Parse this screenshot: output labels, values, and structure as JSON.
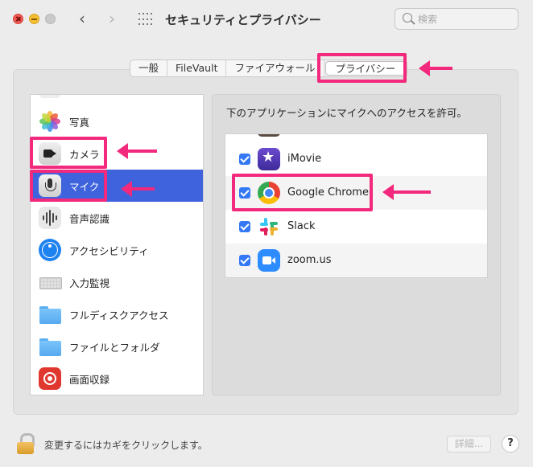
{
  "window": {
    "title": "セキュリティとプライバシー",
    "search_placeholder": "検索"
  },
  "tabs": [
    {
      "label": "一般",
      "active": false
    },
    {
      "label": "FileVault",
      "active": false
    },
    {
      "label": "ファイアウォール",
      "active": false
    },
    {
      "label": "プライバシー",
      "active": true
    }
  ],
  "sidebar": {
    "items": [
      {
        "label": "写真",
        "icon": "photos-icon",
        "selected": false
      },
      {
        "label": "カメラ",
        "icon": "camera-icon",
        "selected": false
      },
      {
        "label": "マイク",
        "icon": "microphone-icon",
        "selected": true
      },
      {
        "label": "音声認識",
        "icon": "speech-recognition-icon",
        "selected": false
      },
      {
        "label": "アクセシビリティ",
        "icon": "accessibility-icon",
        "selected": false
      },
      {
        "label": "入力監視",
        "icon": "keyboard-icon",
        "selected": false
      },
      {
        "label": "フルディスクアクセス",
        "icon": "folder-icon",
        "selected": false
      },
      {
        "label": "ファイルとフォルダ",
        "icon": "folder-icon",
        "selected": false
      },
      {
        "label": "画面収録",
        "icon": "screen-recording-icon",
        "selected": false
      }
    ]
  },
  "detail": {
    "heading": "下のアプリケーションにマイクへのアクセスを許可。",
    "apps": [
      {
        "name": "iMovie",
        "checked": true,
        "icon": "imovie-icon"
      },
      {
        "name": "Google Chrome",
        "checked": true,
        "icon": "chrome-icon"
      },
      {
        "name": "Slack",
        "checked": true,
        "icon": "slack-icon"
      },
      {
        "name": "zoom.us",
        "checked": true,
        "icon": "zoom-icon"
      }
    ]
  },
  "footer": {
    "lock_text": "変更するにはカギをクリックします。",
    "details_label": "詳細...",
    "help_label": "?"
  },
  "colors": {
    "selection": "#3e63dd",
    "checkbox": "#3478f6",
    "annotation": "#f2297c"
  }
}
